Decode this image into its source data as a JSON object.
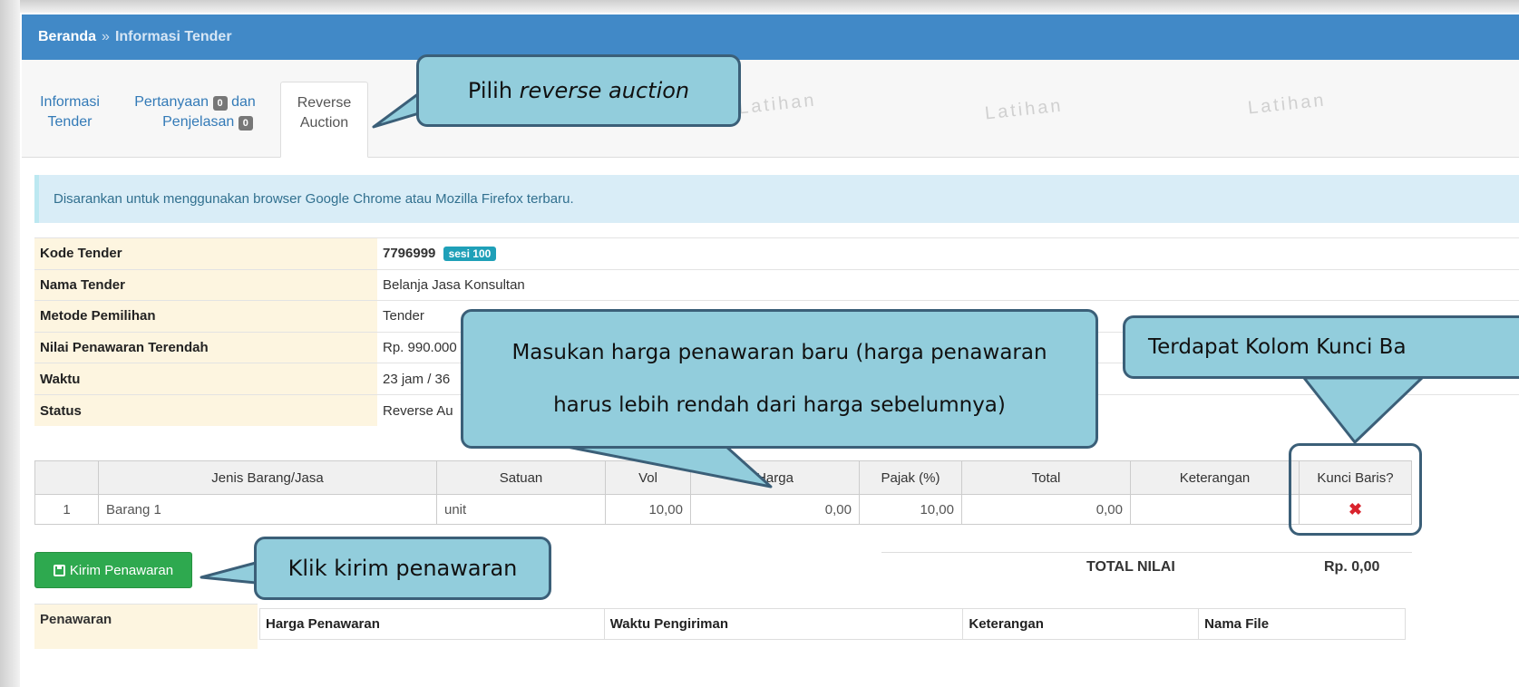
{
  "breadcrumb": {
    "home": "Beranda",
    "separator": "»",
    "current": "Informasi Tender"
  },
  "tabs": {
    "info_line1": "Informasi",
    "info_line2": "Tender",
    "pertanyaan_line1": "Pertanyaan",
    "pertanyaan_count": "0",
    "pertanyaan_and": "dan",
    "penjelasan": "Penjelasan",
    "penjelasan_count": "0",
    "reverse_line1": "Reverse",
    "reverse_line2": "Auction"
  },
  "watermark": "Latihan",
  "alert": "Disarankan untuk menggunakan browser Google Chrome atau Mozilla Firefox terbaru.",
  "info": {
    "kode_label": "Kode Tender",
    "kode_value": "7796999",
    "sesi_badge": "sesi 100",
    "nama_label": "Nama Tender",
    "nama_value": "Belanja Jasa Konsultan",
    "metode_label": "Metode Pemilihan",
    "metode_value": "Tender",
    "nilai_label": "Nilai Penawaran Terendah",
    "nilai_value": "Rp. 990.000",
    "waktu_label": "Waktu",
    "waktu_value": "23 jam / 36",
    "status_label": "Status",
    "status_value": "Reverse Au"
  },
  "items_table": {
    "headers": [
      "",
      "Jenis Barang/Jasa",
      "Satuan",
      "Vol",
      "Harga",
      "Pajak (%)",
      "Total",
      "Keterangan",
      "Kunci Baris?"
    ],
    "rows": [
      {
        "no": "1",
        "jenis": "Barang 1",
        "satuan": "unit",
        "vol": "10,00",
        "harga": "0,00",
        "pajak": "10,00",
        "total": "0,00",
        "keterangan": "",
        "kunci": "✖"
      }
    ]
  },
  "kirim_button": "Kirim Penawaran",
  "total": {
    "label": "TOTAL NILAI",
    "value": "Rp. 0,00"
  },
  "penawaran": {
    "label": "Penawaran",
    "headers": [
      "Harga Penawaran",
      "Waktu Pengiriman",
      "Keterangan",
      "Nama File"
    ]
  },
  "callouts": {
    "reverse": {
      "text_plain": "Pilih ",
      "text_italic": "reverse auction"
    },
    "harga_line1": "Masukan harga penawaran baru (harga penawaran",
    "harga_line2": "harus lebih rendah dari harga sebelumnya)",
    "kunci": "Terdapat Kolom Kunci Ba",
    "kirim": "Klik kirim penawaran"
  },
  "colors": {
    "header": "#4189c7",
    "callout_fill": "#92cddc",
    "callout_border": "#3b5f78",
    "button": "#2ea94f"
  }
}
